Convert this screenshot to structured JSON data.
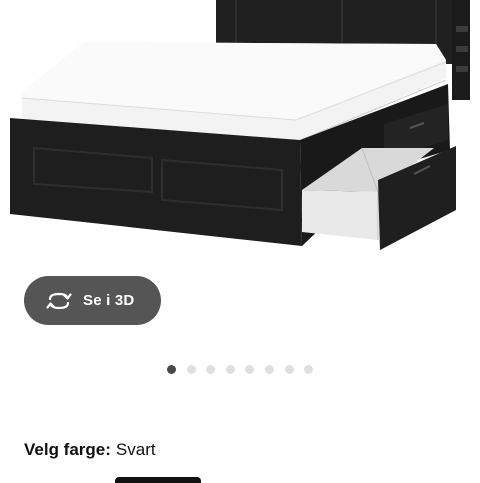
{
  "product_image": {
    "icon": "product-photo-bed-frame-with-drawers"
  },
  "view_3d": {
    "label": "Se i 3D",
    "icon": "rotate-3d-icon"
  },
  "carousel": {
    "total": 8,
    "active_index": 0
  },
  "color_selector": {
    "caption": "Velg farge:",
    "value": "Svart"
  },
  "colors": {
    "button_bg": "#555555",
    "dot_active": "#484848",
    "dot_inactive": "#dfdfdf",
    "frame": "#1e1e1e"
  }
}
